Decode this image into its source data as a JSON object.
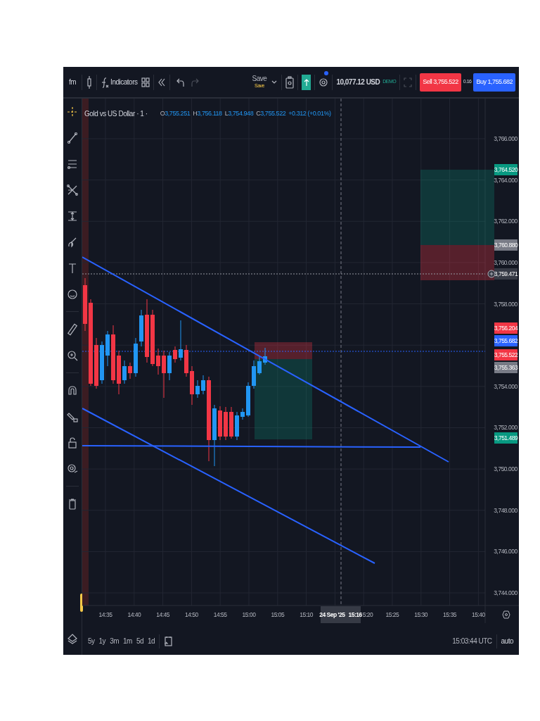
{
  "toolbar": {
    "symbol_button": "fm",
    "indicators_button": "Indicators",
    "undo": {
      "disabled": false
    },
    "redo": {
      "disabled": true
    },
    "save_button": {
      "label": "Save",
      "sublabel": "Save"
    },
    "balance": "10,077.12 USD",
    "account_mode": "DEMO",
    "sell_button": "Sell 3,755.522",
    "spread": "0.16",
    "buy_button": "Buy 1,755.682"
  },
  "legend": {
    "title": "Gold vs US Dollar · 1 ·",
    "values": [
      {
        "label": "O",
        "value": "3,755.251"
      },
      {
        "label": "H",
        "value": "3,756.118"
      },
      {
        "label": "L",
        "value": "3,754.948"
      },
      {
        "label": "C",
        "value": "3,755.522"
      }
    ],
    "change": "+0.312 (+0.01%)"
  },
  "price_axis": {
    "ticks": [
      "3,766.000",
      "3,764.000",
      "3,762.000",
      "3,760.000",
      "3,758.000",
      "3,754.000",
      "3,752.000",
      "3,750.000",
      "3,748.000",
      "3,746.000",
      "3,744.000"
    ],
    "labels": [
      {
        "text": "3,764.520",
        "color": "#089981"
      },
      {
        "text": "3,760.880",
        "color": "#787b86"
      },
      {
        "text": "3,759.471",
        "color": "#363a45"
      },
      {
        "text": "3,756.204",
        "color": "#f23645"
      },
      {
        "text": "3,755.682",
        "color": "#2962ff"
      },
      {
        "text": "3,755.522",
        "color": "#f23645"
      },
      {
        "text": "3,755.363",
        "color": "#787b86"
      },
      {
        "text": "3,751.489",
        "color": "#089981"
      }
    ]
  },
  "time_axis": {
    "ticks": [
      "14:35",
      "14:40",
      "14:45",
      "14:50",
      "14:55",
      "15:00",
      "15:05",
      "15:10",
      "5:20",
      "15:25",
      "15:30",
      "15:35",
      "15:40"
    ],
    "crosshair": {
      "date": "24 Sep '25",
      "time": "15:16"
    }
  },
  "bottom_bar": {
    "ranges": [
      "5y",
      "1y",
      "3m",
      "1m",
      "5d",
      "1d"
    ],
    "clock": "15:03:44 UTC",
    "scale_mode": "auto"
  }
}
